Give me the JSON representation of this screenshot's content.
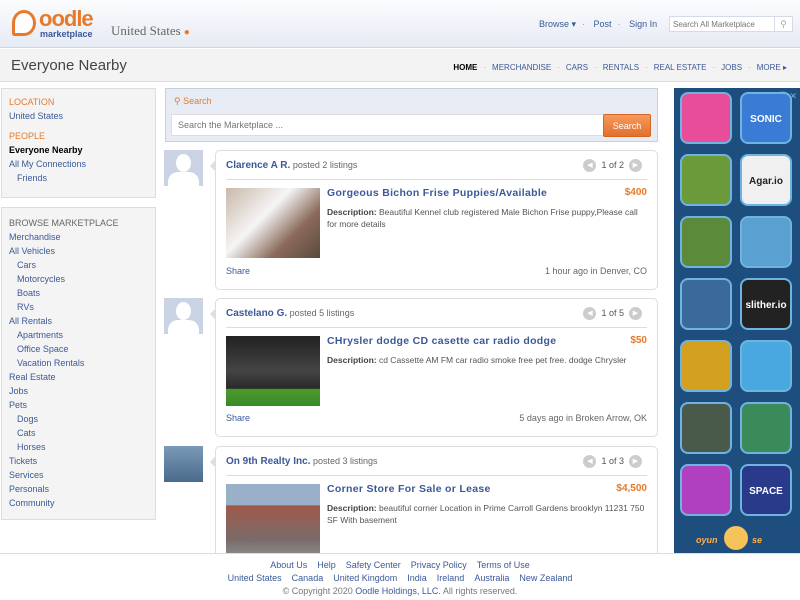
{
  "header": {
    "logo_top": "oodle",
    "logo_bottom": "marketplace",
    "location": "United States",
    "nav": {
      "browse": "Browse ▾",
      "post": "Post",
      "sign_in": "Sign In"
    },
    "search_placeholder": "Search All Marketplace"
  },
  "subheader": {
    "title": "Everyone Nearby",
    "nav": [
      "HOME",
      "MERCHANDISE",
      "CARS",
      "RENTALS",
      "REAL ESTATE",
      "JOBS",
      "MORE ▸"
    ]
  },
  "sidebar": {
    "location_heading": "LOCATION",
    "location": "United States",
    "people_heading": "PEOPLE",
    "people_current": "Everyone Nearby",
    "people_links": [
      "All My Connections",
      "Friends"
    ],
    "browse_heading": "BROWSE MARKETPLACE",
    "browse": [
      {
        "label": "Merchandise",
        "indent": false
      },
      {
        "label": "All Vehicles",
        "indent": false
      },
      {
        "label": "Cars",
        "indent": true
      },
      {
        "label": "Motorcycles",
        "indent": true
      },
      {
        "label": "Boats",
        "indent": true
      },
      {
        "label": "RVs",
        "indent": true
      },
      {
        "label": "All Rentals",
        "indent": false
      },
      {
        "label": "Apartments",
        "indent": true
      },
      {
        "label": "Office Space",
        "indent": true
      },
      {
        "label": "Vacation Rentals",
        "indent": true
      },
      {
        "label": "Real Estate",
        "indent": false
      },
      {
        "label": "Jobs",
        "indent": false
      },
      {
        "label": "Pets",
        "indent": false
      },
      {
        "label": "Dogs",
        "indent": true
      },
      {
        "label": "Cats",
        "indent": true
      },
      {
        "label": "Horses",
        "indent": true
      },
      {
        "label": "Tickets",
        "indent": false
      },
      {
        "label": "Services",
        "indent": false
      },
      {
        "label": "Personals",
        "indent": false
      },
      {
        "label": "Community",
        "indent": false
      }
    ]
  },
  "search": {
    "label": "Search",
    "placeholder": "Search the Marketplace ...",
    "button": "Search"
  },
  "listings": [
    {
      "user": "Clarence A R.",
      "posted": "posted 2 listings",
      "pager": "1 of 2",
      "title": "Gorgeous Bichon Frise Puppies/Available",
      "price": "$400",
      "desc_label": "Description:",
      "desc": "Beautiful Kennel club registered Male Bichon Frise puppy,Please call for more details",
      "share": "Share",
      "when": "1 hour ago in Denver, CO"
    },
    {
      "user": "Castelano G.",
      "posted": "posted 5 listings",
      "pager": "1 of 5",
      "title": "CHrysler dodge CD casette car radio dodge",
      "price": "$50",
      "desc_label": "Description:",
      "desc": "cd Cassette AM FM car radio smoke free pet free. dodge Chrysler",
      "share": "Share",
      "when": "5 days ago in Broken Arrow, OK"
    },
    {
      "user": "On 9th Realty Inc.",
      "posted": "posted 3 listings",
      "pager": "1 of 3",
      "title": "Corner Store For Sale or Lease",
      "price": "$4,500",
      "desc_label": "Description:",
      "desc": "beautiful corner Location in Prime Carroll Gardens brooklyn 11231 750 SF With basement",
      "share": "",
      "when": ""
    }
  ],
  "ad": {
    "tiles": [
      "",
      "SONIC",
      "",
      "Agar.io",
      "",
      "",
      "",
      "slither.io",
      "",
      "",
      "",
      "",
      "",
      "SPACE"
    ],
    "tile_colors": [
      "#e84d9a",
      "#3a7bd5",
      "#6a9a3a",
      "#f0f0f0",
      "#5a8a3a",
      "#5aa0d0",
      "#3a6a9a",
      "#222",
      "#d4a020",
      "#4aa8e0",
      "#4a5a4a",
      "#3a8a5a",
      "#b040c0",
      "#2a3a8a"
    ],
    "brand_left": "oyun",
    "brand_right": "se"
  },
  "footer": {
    "links": [
      "About Us",
      "Help",
      "Safety Center",
      "Privacy Policy",
      "Terms of Use"
    ],
    "countries": [
      "United States",
      "Canada",
      "United Kingdom",
      "India",
      "Ireland",
      "Australia",
      "New Zealand"
    ],
    "copyright_pre": "© Copyright 2020",
    "company": "Oodle Holdings, LLC.",
    "copyright_post": "All rights reserved."
  }
}
